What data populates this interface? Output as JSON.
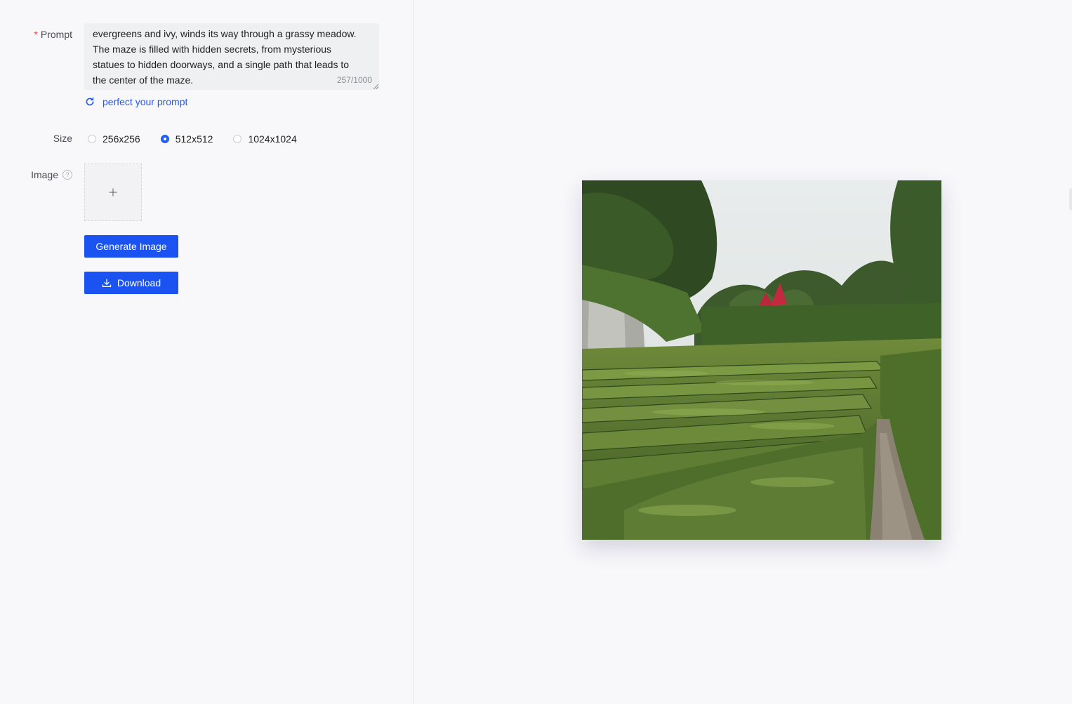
{
  "form": {
    "prompt": {
      "label": "Prompt",
      "required_mark": "*",
      "value": "evergreens and ivy, winds its way through a grassy meadow.\nThe maze is filled with hidden secrets, from mysterious\nstatues to hidden doorways, and a single path that leads to\nthe center of the maze.",
      "char_count": "257/1000"
    },
    "perfect_prompt_label": "perfect your prompt",
    "size": {
      "label": "Size",
      "options": [
        "256x256",
        "512x512",
        "1024x1024"
      ],
      "selected": "512x512"
    },
    "image": {
      "label": "Image",
      "help_icon": "question-circle-icon",
      "upload_icon": "plus-icon"
    },
    "generate_button_label": "Generate Image",
    "download_button_label": "Download"
  },
  "preview": {
    "description_icon": "generated-image"
  },
  "colors": {
    "primary": "#1a53f2",
    "link": "#2457f5",
    "required": "#e5484d",
    "background": "#f8f8fb"
  }
}
